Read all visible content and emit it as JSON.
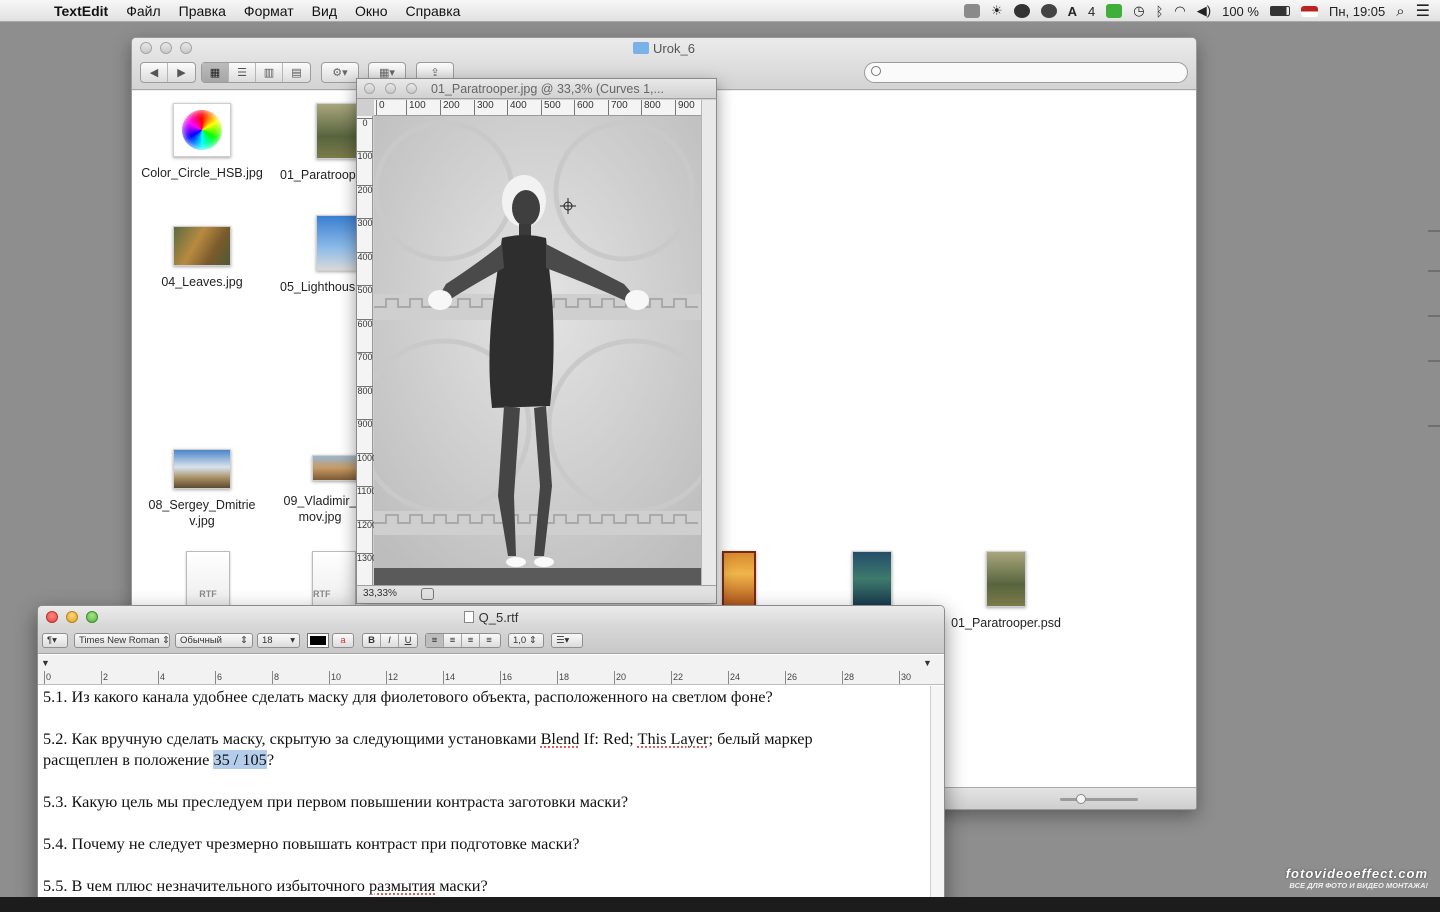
{
  "menubar": {
    "app_name": "TextEdit",
    "menus": [
      "Файл",
      "Правка",
      "Формат",
      "Вид",
      "Окно",
      "Справка"
    ],
    "status_items": [
      "4"
    ],
    "battery": "100 %",
    "clock": "Пн, 19:05"
  },
  "finder": {
    "title": "Urok_6",
    "search_placeholder": "",
    "files": [
      {
        "name": "Color_Circle_HSB.jpg"
      },
      {
        "name": "01_Paratroop"
      },
      {
        "name": "04_Leaves.jpg"
      },
      {
        "name": "05_Lighthous"
      },
      {
        "name": "08_Sergey_Dmitriev.jpg"
      },
      {
        "name": "09_Vladimir_mov.jpg"
      },
      {
        "name": "01_Paratrooper.psd"
      }
    ],
    "rtf_labels": [
      "RTF",
      "RTF"
    ]
  },
  "photoshop": {
    "title": "01_Paratrooper.jpg @ 33,3% (Curves 1,...",
    "ruler_h": [
      "0",
      "100",
      "200",
      "300",
      "400",
      "500",
      "600",
      "700",
      "800",
      "900"
    ],
    "ruler_v": [
      "0",
      "100",
      "200",
      "300",
      "400",
      "500",
      "600",
      "700",
      "800",
      "900",
      "1000",
      "1100",
      "1200",
      "1300"
    ],
    "zoom": "33,33%"
  },
  "textedit": {
    "title": "Q_5.rtf",
    "toolbar": {
      "paragraph": "¶▾",
      "font": "Times New Roman",
      "style": "Обычный",
      "size": "18",
      "bold": "B",
      "italic": "I",
      "underline": "U",
      "spacing": "1,0",
      "list": "☰▾"
    },
    "ruler_ticks": [
      "0",
      "2",
      "4",
      "6",
      "8",
      "10",
      "12",
      "14",
      "16",
      "18",
      "20",
      "22",
      "24",
      "26",
      "28",
      "30"
    ],
    "lines": {
      "q1": "5.1. Из какого канала удобнее сделать маску для фиолетового объекта, расположенного на светлом фоне?",
      "q2_a": "5.2. Как вручную сделать маску, скрытую за следующими установками ",
      "q2_b": "Blend",
      "q2_c": " If: Red; ",
      "q2_d": "This Layer",
      "q2_e": "; белый маркер",
      "q2_f": "расщеплен в положение ",
      "q2_sel": "35 / 105",
      "q2_end": "?",
      "q3": "5.3. Какую цель мы преследуем при первом повышении контраста заготовки маски?",
      "q4": "5.4. Почему не следует чрезмерно повышать контраст при подготовке маски?",
      "q5_a": "5.5. В чем плюс незначительного избыточного ",
      "q5_b": "размытия",
      "q5_c": " маски?"
    }
  },
  "watermark": {
    "line1": "fotovideoeffect.com",
    "line2": "ВСЕ ДЛЯ ФОТО И ВИДЕО МОНТАЖА!"
  }
}
